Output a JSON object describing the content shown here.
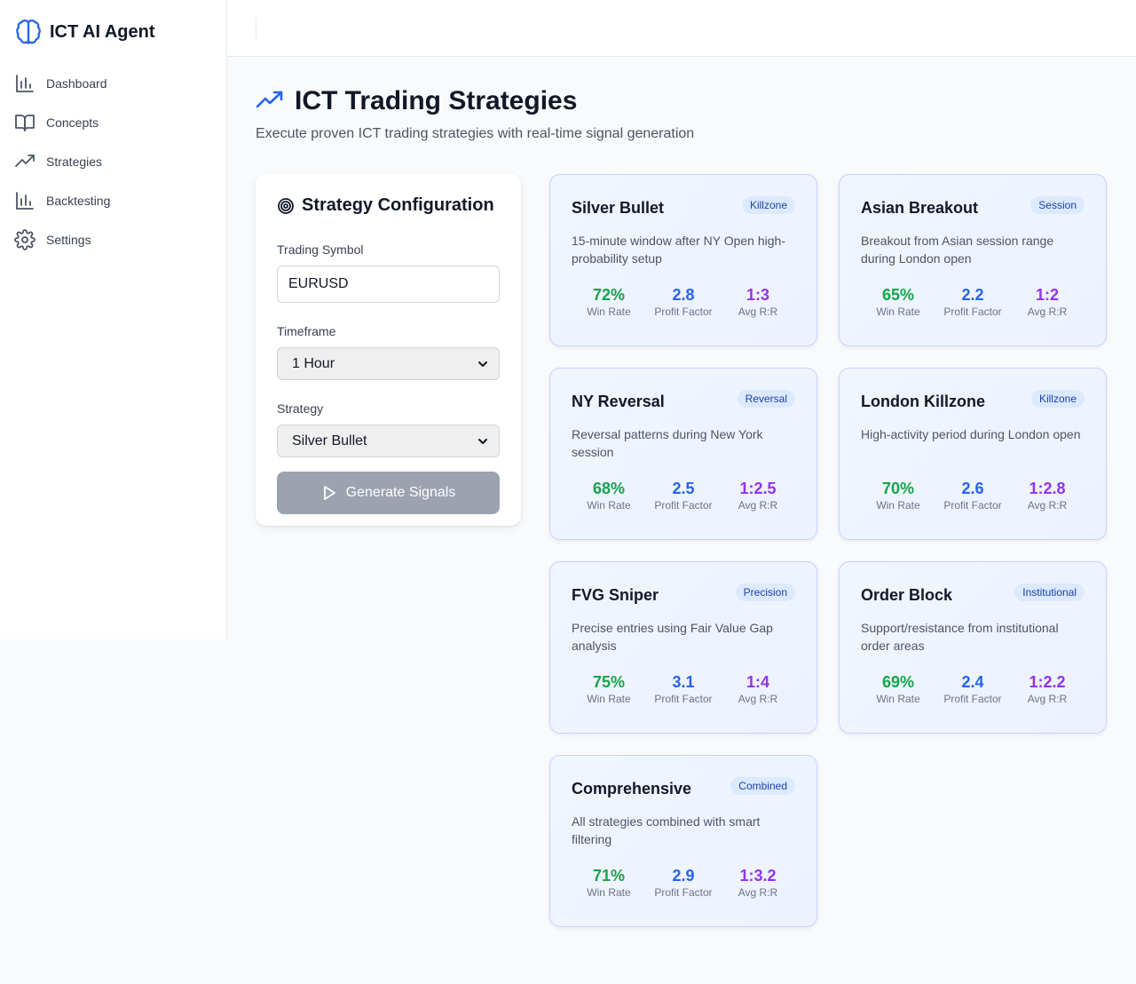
{
  "app": {
    "title": "ICT AI Agent"
  },
  "sidebar": {
    "items": [
      {
        "label": "Dashboard",
        "icon": "bar-chart-icon"
      },
      {
        "label": "Concepts",
        "icon": "book-icon"
      },
      {
        "label": "Strategies",
        "icon": "trending-up-icon"
      },
      {
        "label": "Backtesting",
        "icon": "bar-chart-icon"
      },
      {
        "label": "Settings",
        "icon": "gear-icon"
      }
    ]
  },
  "page": {
    "title": "ICT Trading Strategies",
    "subtitle": "Execute proven ICT trading strategies with real-time signal generation"
  },
  "config": {
    "title": "Strategy Configuration",
    "symbol_label": "Trading Symbol",
    "symbol_value": "EURUSD",
    "timeframe_label": "Timeframe",
    "timeframe_value": "1 Hour",
    "strategy_label": "Strategy",
    "strategy_value": "Silver Bullet",
    "generate_label": "Generate Signals"
  },
  "metric_labels": {
    "win": "Win Rate",
    "pf": "Profit Factor",
    "rr": "Avg R:R"
  },
  "colors": {
    "accent": "#2563eb",
    "win": "#16a34a",
    "pf": "#2563eb",
    "rr": "#9333ea"
  },
  "strategies": [
    {
      "name": "Silver Bullet",
      "badge": "Killzone",
      "desc": "15-minute window after NY Open high-probability setup",
      "win": "72%",
      "pf": "2.8",
      "rr": "1:3"
    },
    {
      "name": "Asian Breakout",
      "badge": "Session",
      "desc": "Breakout from Asian session range during London open",
      "win": "65%",
      "pf": "2.2",
      "rr": "1:2"
    },
    {
      "name": "NY Reversal",
      "badge": "Reversal",
      "desc": "Reversal patterns during New York session",
      "win": "68%",
      "pf": "2.5",
      "rr": "1:2.5"
    },
    {
      "name": "London Killzone",
      "badge": "Killzone",
      "desc": "High-activity period during London open",
      "win": "70%",
      "pf": "2.6",
      "rr": "1:2.8"
    },
    {
      "name": "FVG Sniper",
      "badge": "Precision",
      "desc": "Precise entries using Fair Value Gap analysis",
      "win": "75%",
      "pf": "3.1",
      "rr": "1:4"
    },
    {
      "name": "Order Block",
      "badge": "Institutional",
      "desc": "Support/resistance from institutional order areas",
      "win": "69%",
      "pf": "2.4",
      "rr": "1:2.2"
    },
    {
      "name": "Comprehensive",
      "badge": "Combined",
      "desc": "All strategies combined with smart filtering",
      "win": "71%",
      "pf": "2.9",
      "rr": "1:3.2"
    }
  ]
}
